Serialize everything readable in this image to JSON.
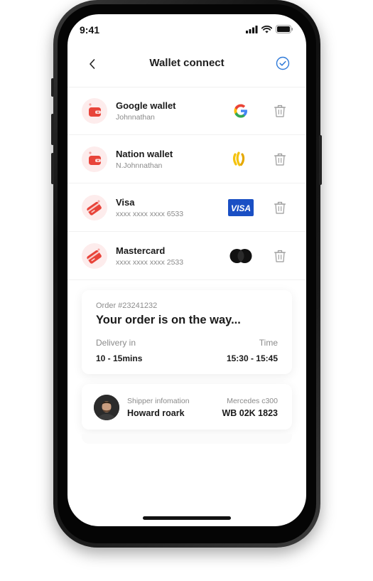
{
  "status_bar": {
    "time": "9:41"
  },
  "header": {
    "title": "Wallet connect"
  },
  "wallets": [
    {
      "name": "Google wallet",
      "subtitle": "Johnnathan",
      "icon": "wallet-icon",
      "brand": "google-logo"
    },
    {
      "name": "Nation wallet",
      "subtitle": "N.Johnnathan",
      "icon": "wallet-icon",
      "brand": "nation-logo"
    },
    {
      "name": "Visa",
      "subtitle": "xxxx xxxx xxxx 6533",
      "icon": "card-icon",
      "brand": "visa-logo",
      "brand_text": "VISA"
    },
    {
      "name": "Mastercard",
      "subtitle": "xxxx xxxx xxxx 2533",
      "icon": "card-icon",
      "brand": "mastercard-logo"
    }
  ],
  "order": {
    "number": "Order #23241232",
    "title": "Your order is on the way...",
    "delivery_label": "Delivery in",
    "delivery_value": "10 - 15mins",
    "time_label": "Time",
    "time_value": "15:30 - 15:45"
  },
  "shipper": {
    "label": "Shipper infomation",
    "name": "Howard roark",
    "vehicle_label": "Mercedes c300",
    "plate": "WB 02K 1823"
  },
  "colors": {
    "accent": "#2f7ad8",
    "wallet_icon_bg": "#fdecec",
    "wallet_icon_red": "#e8443a",
    "visa_blue": "#1a4fc4"
  }
}
